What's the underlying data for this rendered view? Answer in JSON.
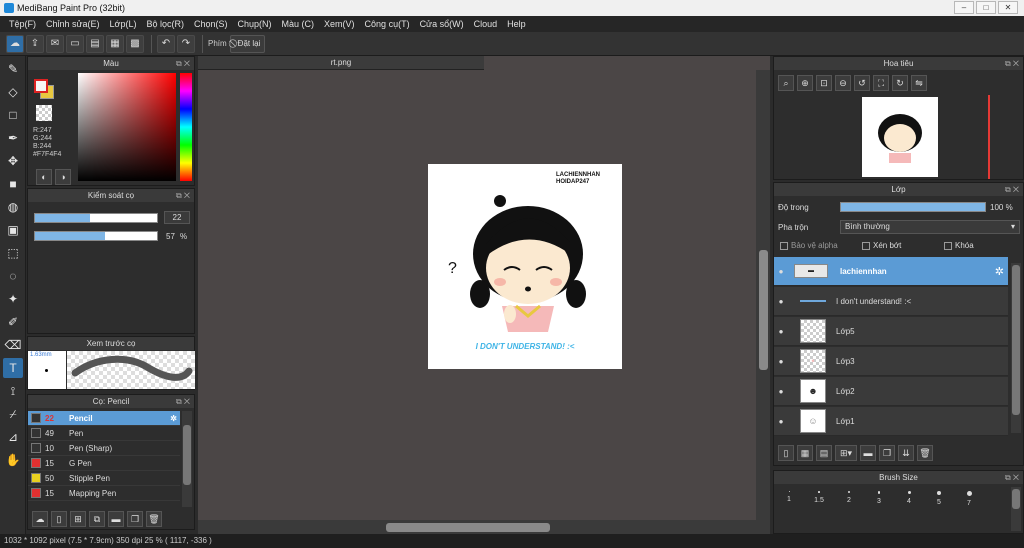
{
  "window": {
    "title": "MediBang Paint Pro (32bit)",
    "controls": [
      "–",
      "□",
      "✕"
    ]
  },
  "menu": [
    "Tệp(F)",
    "Chỉnh sửa(E)",
    "Lớp(L)",
    "Bộ lọc(R)",
    "Chọn(S)",
    "Chụp(N)",
    "Màu (C)",
    "Xem(V)",
    "Công cụ(T)",
    "Cửa sổ(W)",
    "Cloud",
    "Help"
  ],
  "toolbar": {
    "key_label": "Phím",
    "reset_label": "Đặt lại"
  },
  "color_panel": {
    "title": "Màu",
    "r": "R:247",
    "g": "G:244",
    "b": "B:244",
    "hex": "#F7F4F4",
    "primary": "#F7F4F4",
    "secondary": "#e8c840"
  },
  "brush_control": {
    "title": "Kiểm soát cọ",
    "size_value": "22",
    "opacity_value": "57",
    "opacity_unit": "%",
    "size_fraction": 0.45,
    "opacity_fraction": 0.57
  },
  "brush_preview": {
    "title": "Xem trước cọ",
    "size_label": "1.63mm"
  },
  "brush_list": {
    "title": "Cọ: Pencil",
    "items": [
      {
        "size": "22",
        "name": "Pencil",
        "color": "#333333",
        "selected": true
      },
      {
        "size": "49",
        "name": "Pen",
        "color": "#333333"
      },
      {
        "size": "10",
        "name": "Pen (Sharp)",
        "color": "#333333"
      },
      {
        "size": "15",
        "name": "G Pen",
        "color": "#e03030"
      },
      {
        "size": "50",
        "name": "Stipple Pen",
        "color": "#e8d020"
      },
      {
        "size": "15",
        "name": "Mapping Pen",
        "color": "#e03030"
      }
    ]
  },
  "canvas": {
    "tab": "rt.png",
    "art_text_top": "LACHIENNHAN\nHOIDAP247",
    "art_caption": "I DON'T UNDERSTAND! :<",
    "art_question": "?"
  },
  "navigator": {
    "title": "Hoa tiêu"
  },
  "layer_panel": {
    "title": "Lớp",
    "opacity_label": "Độ trong",
    "opacity_value": "100 %",
    "blend_label": "Pha trộn",
    "blend_value": "Bình thường",
    "protect_alpha": "Bảo vệ alpha",
    "clipping": "Xén bớt",
    "lock": "Khóa",
    "layers": [
      {
        "name": "lachiennhan",
        "selected": true,
        "thumb": "text"
      },
      {
        "name": "I don't understand! :<",
        "thumb": "line"
      },
      {
        "name": "Lớp5",
        "thumb": "blank"
      },
      {
        "name": "Lớp3",
        "thumb": "dot"
      },
      {
        "name": "Lớp2",
        "thumb": "face"
      },
      {
        "name": "Lớp1",
        "thumb": "sketch"
      }
    ]
  },
  "brush_size_panel": {
    "title": "Brush Size",
    "sizes": [
      "1",
      "1.5",
      "2",
      "3",
      "4",
      "5",
      "7"
    ]
  },
  "status": {
    "text": "1032 * 1092 pixel   (7.5 * 7.9cm)   350 dpi   25 %   ( 1117, -336 )"
  }
}
